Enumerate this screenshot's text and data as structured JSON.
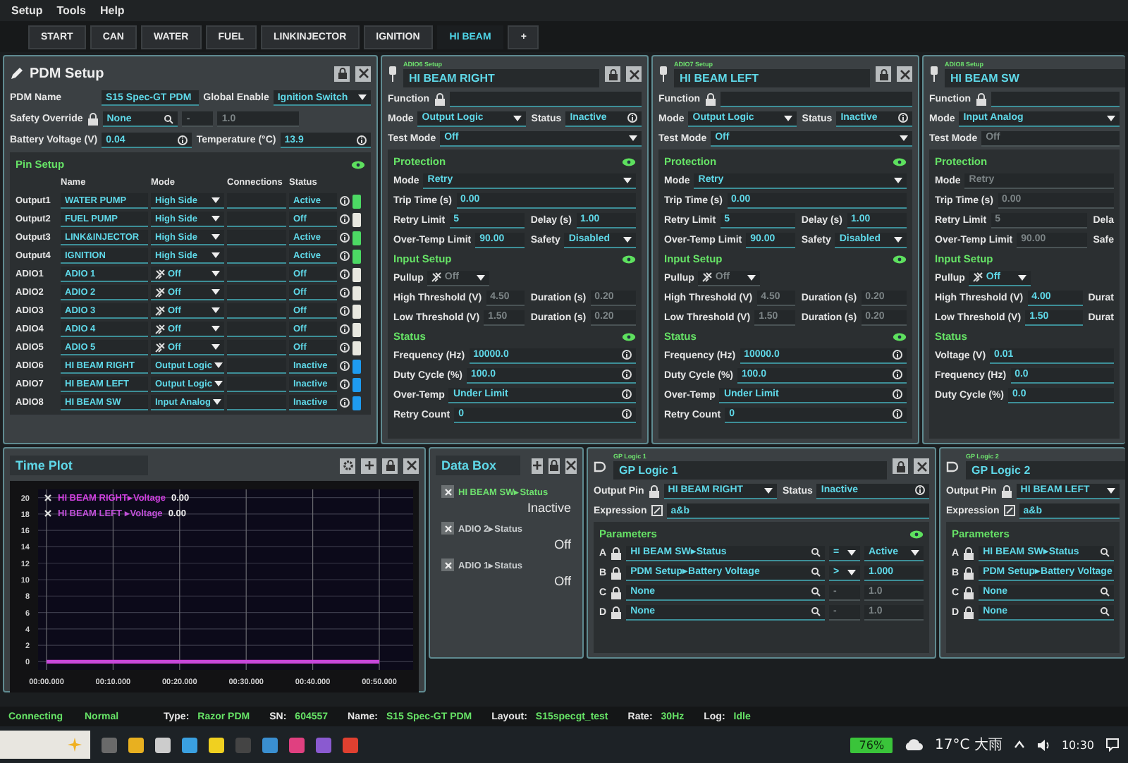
{
  "menu": [
    "Setup",
    "Tools",
    "Help"
  ],
  "tabs": [
    {
      "label": "START",
      "selected": false
    },
    {
      "label": "CAN",
      "selected": false
    },
    {
      "label": "WATER",
      "selected": false
    },
    {
      "label": "FUEL",
      "selected": false
    },
    {
      "label": "LINKINJECTOR",
      "selected": false
    },
    {
      "label": "IGNITION",
      "selected": false
    },
    {
      "label": "HI BEAM",
      "selected": true
    },
    {
      "label": "+",
      "selected": false
    }
  ],
  "pdm_setup": {
    "title": "PDM Setup",
    "pdm_name": {
      "label": "PDM Name",
      "value": "S15 Spec-GT PDM"
    },
    "global_enable": {
      "label": "Global Enable",
      "value": "Ignition Switch"
    },
    "safety_override": {
      "label": "Safety Override",
      "value": "None",
      "operator": "-",
      "threshold": "1.0"
    },
    "battery_voltage": {
      "label": "Battery Voltage (V)",
      "value": "0.04"
    },
    "temperature": {
      "label": "Temperature (°C)",
      "value": "13.9"
    },
    "pin_setup": {
      "title": "Pin Setup",
      "columns": [
        "Name",
        "Mode",
        "Connections",
        "Status"
      ],
      "rows": [
        {
          "pin": "Output1",
          "name": "WATER PUMP",
          "mode": "High Side",
          "kind": "plain",
          "status": "Active",
          "color": "#4cd964"
        },
        {
          "pin": "Output2",
          "name": "FUEL PUMP",
          "mode": "High Side",
          "kind": "plain",
          "status": "Off",
          "color": "#e8e8e0"
        },
        {
          "pin": "Output3",
          "name": "LINK&INJECTOR",
          "mode": "High Side",
          "kind": "plain",
          "status": "Active",
          "color": "#4cd964"
        },
        {
          "pin": "Output4",
          "name": "IGNITION",
          "mode": "High Side",
          "kind": "plain",
          "status": "Active",
          "color": "#4cd964"
        },
        {
          "pin": "ADIO1",
          "name": "ADIO 1",
          "mode": "Off",
          "kind": "pin",
          "status": "Off",
          "color": "#e8e8e0"
        },
        {
          "pin": "ADIO2",
          "name": "ADIO 2",
          "mode": "Off",
          "kind": "pin",
          "status": "Off",
          "color": "#e8e8e0"
        },
        {
          "pin": "ADIO3",
          "name": "ADIO 3",
          "mode": "Off",
          "kind": "pin",
          "status": "Off",
          "color": "#e8e8e0"
        },
        {
          "pin": "ADIO4",
          "name": "ADIO 4",
          "mode": "Off",
          "kind": "pin",
          "status": "Off",
          "color": "#e8e8e0"
        },
        {
          "pin": "ADIO5",
          "name": "ADIO 5",
          "mode": "Off",
          "kind": "pin",
          "status": "Off",
          "color": "#e8e8e0"
        },
        {
          "pin": "ADIO6",
          "name": "HI BEAM RIGHT",
          "mode": "Output Logic",
          "kind": "plain",
          "status": "Inactive",
          "color": "#1e9bf0"
        },
        {
          "pin": "ADIO7",
          "name": "HI BEAM LEFT",
          "mode": "Output Logic",
          "kind": "plain",
          "status": "Inactive",
          "color": "#1e9bf0"
        },
        {
          "pin": "ADIO8",
          "name": "HI BEAM SW",
          "mode": "Input Analog",
          "kind": "plain",
          "status": "Inactive",
          "color": "#1e9bf0"
        }
      ]
    }
  },
  "adio_panels": [
    {
      "subtitle": "ADIO6 Setup",
      "name": "HI BEAM RIGHT",
      "edge_controls": true,
      "rows": [
        [
          {
            "label": "Function",
            "kind": "lock_text",
            "disabled": false
          }
        ],
        [
          {
            "label": "Mode",
            "kind": "select",
            "value": "Output Logic",
            "disabled": false
          },
          {
            "label": "Status",
            "kind": "info",
            "value": "Inactive",
            "disabled": false
          }
        ],
        [
          {
            "label": "Test Mode",
            "kind": "select",
            "value": "Off",
            "disabled": false
          }
        ]
      ],
      "sections": [
        {
          "title": "Protection",
          "rows": [
            [
              {
                "label": "Mode",
                "kind": "select",
                "value": "Retry",
                "disabled": false
              }
            ],
            [
              {
                "label": "Trip Time (s)",
                "kind": "text",
                "value": "0.00",
                "disabled": false
              }
            ],
            [
              {
                "label": "Retry Limit",
                "kind": "text",
                "value": "5",
                "disabled": false
              },
              {
                "label": "Delay (s)",
                "kind": "text",
                "value": "1.00",
                "disabled": false
              }
            ],
            [
              {
                "label": "Over-Temp Limit",
                "kind": "text",
                "value": "90.00",
                "disabled": false
              },
              {
                "label": "Safety",
                "kind": "select",
                "value": "Disabled",
                "disabled": false
              }
            ]
          ]
        },
        {
          "title": "Input Setup",
          "rows": [
            [
              {
                "label": "Pullup",
                "kind": "pin_select",
                "value": "Off",
                "disabled": true
              }
            ],
            [
              {
                "label": "High Threshold (V)",
                "kind": "text",
                "value": "4.50",
                "disabled": true
              },
              {
                "label": "Duration (s)",
                "kind": "text",
                "value": "0.20",
                "disabled": true
              }
            ],
            [
              {
                "label": "Low Threshold (V)",
                "kind": "text",
                "value": "1.50",
                "disabled": true
              },
              {
                "label": "Duration (s)",
                "kind": "text",
                "value": "0.20",
                "disabled": true
              }
            ]
          ]
        },
        {
          "title": "Status",
          "rows": [
            [
              {
                "label": "Frequency (Hz)",
                "kind": "info",
                "value": "10000.0",
                "disabled": false
              }
            ],
            [
              {
                "label": "Duty Cycle (%)",
                "kind": "info",
                "value": "100.0",
                "disabled": false
              }
            ],
            [
              {
                "label": "Over-Temp",
                "kind": "info",
                "value": "Under Limit",
                "disabled": false
              }
            ],
            [
              {
                "label": "Retry Count",
                "kind": "info",
                "value": "0",
                "disabled": false
              }
            ]
          ]
        }
      ]
    },
    {
      "subtitle": "ADIO7 Setup",
      "name": "HI BEAM LEFT",
      "edge_controls": true,
      "rows": [
        [
          {
            "label": "Function",
            "kind": "lock_text",
            "disabled": false
          }
        ],
        [
          {
            "label": "Mode",
            "kind": "select",
            "value": "Output Logic",
            "disabled": false
          },
          {
            "label": "Status",
            "kind": "info",
            "value": "Inactive",
            "disabled": false
          }
        ],
        [
          {
            "label": "Test Mode",
            "kind": "select",
            "value": "Off",
            "disabled": false
          }
        ]
      ],
      "sections": [
        {
          "title": "Protection",
          "rows": [
            [
              {
                "label": "Mode",
                "kind": "select",
                "value": "Retry",
                "disabled": false
              }
            ],
            [
              {
                "label": "Trip Time (s)",
                "kind": "text",
                "value": "0.00",
                "disabled": false
              }
            ],
            [
              {
                "label": "Retry Limit",
                "kind": "text",
                "value": "5",
                "disabled": false
              },
              {
                "label": "Delay (s)",
                "kind": "text",
                "value": "1.00",
                "disabled": false
              }
            ],
            [
              {
                "label": "Over-Temp Limit",
                "kind": "text",
                "value": "90.00",
                "disabled": false
              },
              {
                "label": "Safety",
                "kind": "select",
                "value": "Disabled",
                "disabled": false
              }
            ]
          ]
        },
        {
          "title": "Input Setup",
          "rows": [
            [
              {
                "label": "Pullup",
                "kind": "pin_select",
                "value": "Off",
                "disabled": true
              }
            ],
            [
              {
                "label": "High Threshold (V)",
                "kind": "text",
                "value": "4.50",
                "disabled": true
              },
              {
                "label": "Duration (s)",
                "kind": "text",
                "value": "0.20",
                "disabled": true
              }
            ],
            [
              {
                "label": "Low Threshold (V)",
                "kind": "text",
                "value": "1.50",
                "disabled": true
              },
              {
                "label": "Duration (s)",
                "kind": "text",
                "value": "0.20",
                "disabled": true
              }
            ]
          ]
        },
        {
          "title": "Status",
          "rows": [
            [
              {
                "label": "Frequency (Hz)",
                "kind": "info",
                "value": "10000.0",
                "disabled": false
              }
            ],
            [
              {
                "label": "Duty Cycle (%)",
                "kind": "info",
                "value": "100.0",
                "disabled": false
              }
            ],
            [
              {
                "label": "Over-Temp",
                "kind": "info",
                "value": "Under Limit",
                "disabled": false
              }
            ],
            [
              {
                "label": "Retry Count",
                "kind": "info",
                "value": "0",
                "disabled": false
              }
            ]
          ]
        }
      ]
    },
    {
      "subtitle": "ADIO8 Setup",
      "name": "HI BEAM SW",
      "edge_controls": false,
      "rows": [
        [
          {
            "label": "Function",
            "kind": "lock_text",
            "disabled": false
          }
        ],
        [
          {
            "label": "Mode",
            "kind": "select",
            "value": "Input Analog",
            "disabled": false
          }
        ],
        [
          {
            "label": "Test Mode",
            "kind": "text",
            "value": "Off",
            "disabled": true
          }
        ]
      ],
      "sections": [
        {
          "title": "Protection",
          "rows": [
            [
              {
                "label": "Mode",
                "kind": "text",
                "value": "Retry",
                "disabled": true
              }
            ],
            [
              {
                "label": "Trip Time (s)",
                "kind": "text",
                "value": "0.00",
                "disabled": true
              }
            ],
            [
              {
                "label": "Retry Limit",
                "kind": "text",
                "value": "5",
                "disabled": true
              },
              {
                "label": "Dela",
                "kind": "label"
              }
            ],
            [
              {
                "label": "Over-Temp Limit",
                "kind": "text",
                "value": "90.00",
                "disabled": true
              },
              {
                "label": "Safe",
                "kind": "label"
              }
            ]
          ]
        },
        {
          "title": "Input Setup",
          "rows": [
            [
              {
                "label": "Pullup",
                "kind": "pin_select",
                "value": "Off",
                "disabled": false
              }
            ],
            [
              {
                "label": "High Threshold (V)",
                "kind": "text",
                "value": "4.00",
                "disabled": false
              },
              {
                "label": "Durat",
                "kind": "label"
              }
            ],
            [
              {
                "label": "Low Threshold (V)",
                "kind": "text",
                "value": "1.50",
                "disabled": false
              },
              {
                "label": "Durat",
                "kind": "label"
              }
            ]
          ]
        },
        {
          "title": "Status",
          "rows": [
            [
              {
                "label": "Voltage (V)",
                "kind": "text",
                "value": "0.01",
                "disabled": false
              }
            ],
            [
              {
                "label": "Frequency (Hz)",
                "kind": "text",
                "value": "0.0",
                "disabled": false
              }
            ],
            [
              {
                "label": "Duty Cycle (%)",
                "kind": "text",
                "value": "0.0",
                "disabled": false
              }
            ]
          ]
        }
      ]
    }
  ],
  "time_plot": {
    "title": "Time Plot",
    "readings": [
      "0.00",
      "0.00"
    ],
    "chart_data": {
      "type": "line",
      "grid": true,
      "categories": [
        "00:00.000",
        "00:10.000",
        "00:20.000",
        "00:30.000",
        "00:40.000",
        "00:50.000"
      ],
      "ylim": [
        -1,
        21
      ],
      "yticks": [
        0,
        2,
        4,
        6,
        8,
        10,
        12,
        14,
        16,
        18,
        20
      ],
      "series": [
        {
          "name": "HI BEAM RIGHT▸Voltage",
          "color": "#d040e0",
          "values": [
            0,
            0,
            0,
            0,
            0,
            0
          ]
        },
        {
          "name": "HI BEAM LEFT ▸Voltage",
          "color": "#c050d8",
          "values": [
            0,
            0,
            0,
            0,
            0,
            0
          ]
        }
      ]
    }
  },
  "data_box": {
    "title": "Data Box",
    "items": [
      {
        "label": "HI BEAM SW▸Status",
        "value": "Inactive",
        "selected": true
      },
      {
        "label": "ADIO 2▸Status",
        "value": "Off",
        "selected": false
      },
      {
        "label": "ADIO 1▸Status",
        "value": "Off",
        "selected": false
      }
    ]
  },
  "gp_logic": [
    {
      "subtitle": "GP Logic 1",
      "name": "GP Logic 1",
      "edge_controls": true,
      "output_pin": {
        "label": "Output Pin",
        "value": "HI BEAM RIGHT"
      },
      "status": {
        "label": "Status",
        "value": "Inactive"
      },
      "expression": {
        "label": "Expression",
        "value": "a&b"
      },
      "parameters": {
        "title": "Parameters",
        "rows": [
          {
            "letter": "A",
            "source": "HI BEAM SW▸Status",
            "kind": "select",
            "operator": "=",
            "value": "Active",
            "disabled": false
          },
          {
            "letter": "B",
            "source": "PDM Setup▸Battery Voltage",
            "kind": "text",
            "operator": ">",
            "value": "1.000",
            "disabled": false
          },
          {
            "letter": "C",
            "source": "None",
            "kind": "text",
            "operator": "-",
            "value": "1.0",
            "disabled": true
          },
          {
            "letter": "D",
            "source": "None",
            "kind": "text",
            "operator": "-",
            "value": "1.0",
            "disabled": true
          }
        ]
      }
    },
    {
      "subtitle": "GP Logic 2",
      "name": "GP Logic 2",
      "edge_controls": false,
      "output_pin": {
        "label": "Output Pin",
        "value": "HI BEAM LEFT"
      },
      "expression": {
        "label": "Expression",
        "value": "a&b"
      },
      "parameters": {
        "title": "Parameters",
        "rows": [
          {
            "letter": "A",
            "source": "HI BEAM SW▸Status",
            "kind": "source"
          },
          {
            "letter": "B",
            "source": "PDM Setup▸Battery Voltage",
            "kind": "source"
          },
          {
            "letter": "C",
            "source": "None",
            "kind": "source"
          },
          {
            "letter": "D",
            "source": "None",
            "kind": "source"
          }
        ]
      }
    }
  ],
  "status_bar": {
    "connection": "Connecting",
    "mode": "Normal",
    "items": [
      {
        "label": "Type:",
        "value": "Razor PDM"
      },
      {
        "label": "SN:",
        "value": "604557"
      },
      {
        "label": "Name:",
        "value": "S15 Spec-GT PDM"
      },
      {
        "label": "Layout:",
        "value": "S15specgt_test"
      },
      {
        "label": "Rate:",
        "value": "30Hz"
      },
      {
        "label": "Log:",
        "value": "Idle"
      }
    ]
  },
  "taskbar": {
    "battery": "76%",
    "weather": "17°C 大雨",
    "time": "10:30"
  }
}
